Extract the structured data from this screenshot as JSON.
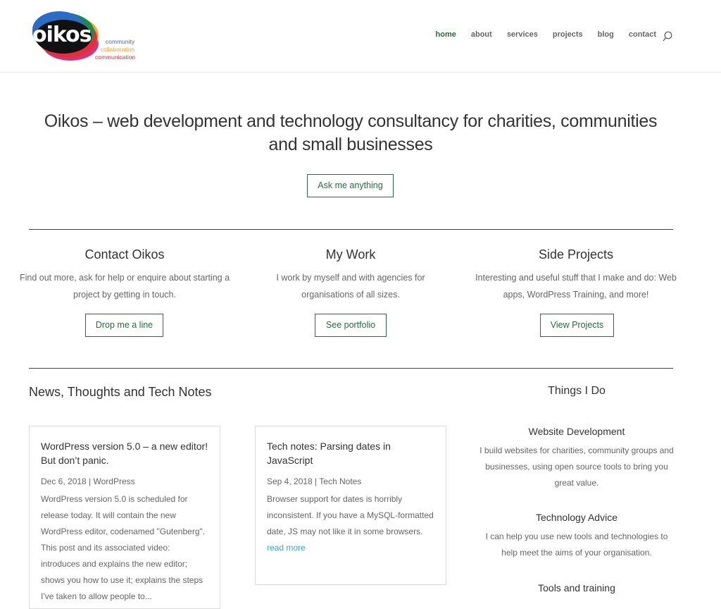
{
  "brand": {
    "logo_text": "oikos",
    "tagline": [
      "community",
      "collaboration",
      "communication"
    ],
    "colors": {
      "accent": "#2a6b40",
      "link": "#2ea3f2",
      "text": "#666666",
      "heading": "#333333"
    }
  },
  "nav": {
    "items": [
      {
        "label": "home",
        "active": true
      },
      {
        "label": "about"
      },
      {
        "label": "services"
      },
      {
        "label": "projects"
      },
      {
        "label": "blog"
      },
      {
        "label": "contact"
      }
    ],
    "search_icon": "search-icon"
  },
  "hero": {
    "title": "Oikos – web development and technology consultancy for charities, communities and small businesses",
    "button": "Ask me anything"
  },
  "columns": [
    {
      "title": "Contact Oikos",
      "text": "Find out more, ask for help or enquire about starting a project by getting in touch.",
      "button": "Drop me a line"
    },
    {
      "title": "My Work",
      "text": "I work by myself and with agencies for organisations of all sizes.",
      "button": "See portfolio"
    },
    {
      "title": "Side Projects",
      "text": "Interesting and useful stuff that I make and do: Web apps, WordPress Training, and more!",
      "button": "View Projects"
    }
  ],
  "news": {
    "title": "News, Thoughts and Tech Notes",
    "posts": [
      {
        "title": "WordPress version 5.0 – a new editor! But don’t panic.",
        "meta": "Dec 6, 2018 | WordPress",
        "excerpt": "WordPress version 5.0 is scheduled for release today. It will contain the new WordPress editor, codenamed \"Gutenberg\". This post and its associated video: introduces and explains the new editor; shows you how to use it; explains the steps I've taken to allow people to..."
      },
      {
        "title": "Tech notes: Parsing dates in JavaScript",
        "meta": "Sep 4, 2018 | Tech Notes",
        "excerpt": "Browser support for dates is horribly inconsistent. If you have a MySQL-formatted date, JS may not like it in some browsers.",
        "read_more": "read more"
      }
    ]
  },
  "things": {
    "title": "Things I Do",
    "items": [
      {
        "title": "Website Development",
        "text": "I build websites for charities, community groups and businesses, using open source tools to bring you great value."
      },
      {
        "title": "Technology Advice",
        "text": "I can help you use new tools and technologies to help meet the aims of your organisation."
      },
      {
        "title": "Tools and training",
        "text": ""
      }
    ]
  }
}
